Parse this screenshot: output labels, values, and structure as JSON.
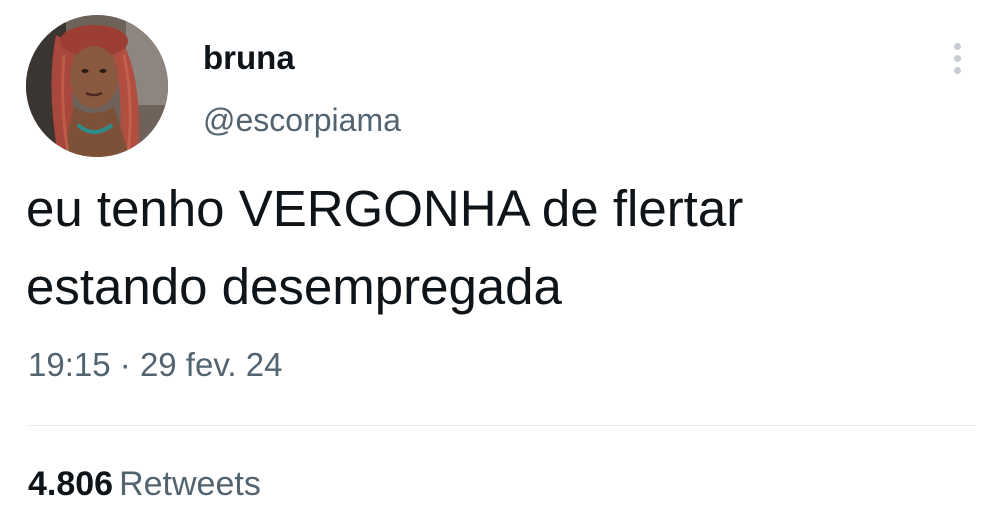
{
  "tweet": {
    "author": {
      "display_name": "bruna",
      "handle": "@escorpiama"
    },
    "text_lines": [
      "eu tenho VERGONHA de flertar",
      "estando desempregada"
    ],
    "time": "19:15",
    "separator": "·",
    "date": "29 fev. 24",
    "retweets": {
      "count": "4.806",
      "label": "Retweets"
    }
  },
  "icons": {
    "more": "more-vertical-icon"
  },
  "colors": {
    "text_primary": "#0f1419",
    "text_secondary": "#536471",
    "divider": "#e6e9ec"
  }
}
